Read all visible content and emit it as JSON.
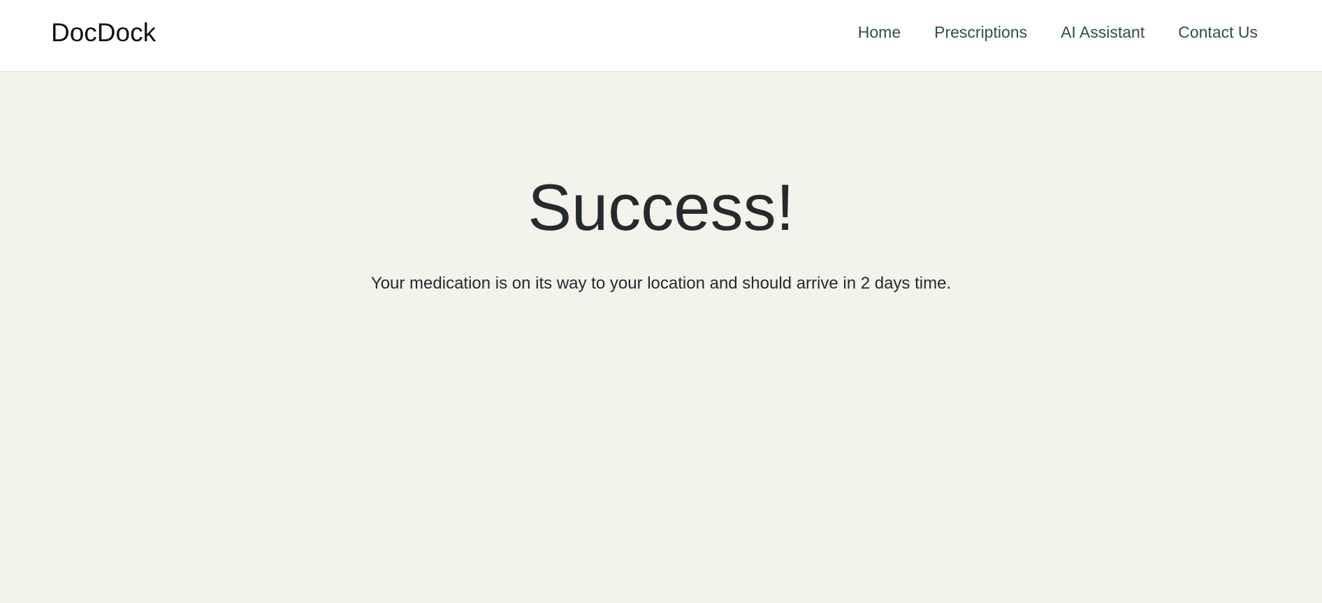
{
  "header": {
    "brand": "DocDock",
    "nav": {
      "items": [
        {
          "label": "Home"
        },
        {
          "label": "Prescriptions"
        },
        {
          "label": "AI Assistant"
        },
        {
          "label": "Contact Us"
        }
      ]
    }
  },
  "main": {
    "title": "Success!",
    "message": "Your medication is on its way to your location and should arrive in 2 days time."
  },
  "colors": {
    "background": "#f3f2eb",
    "navbar": "#ffffff",
    "nav_link": "#2f4f46",
    "text": "#252a2e"
  }
}
